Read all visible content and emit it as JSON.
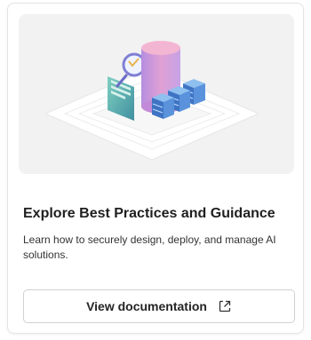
{
  "card": {
    "title": "Explore Best Practices and Guidance",
    "description": "Learn how to securely design, deploy, and manage AI solutions.",
    "button_label": "View documentation",
    "button_icon": "external-link-icon",
    "illustration": "database-servers-illustration"
  },
  "colors": {
    "hero_background": "#f2f2f2",
    "cylinder_top": "#f0a4c6",
    "cylinder_body": "#c59bdc",
    "server_blue": "#4a86cf",
    "document_teal": "#5fb3a8",
    "magnifier_ring": "#7f7fd4"
  }
}
